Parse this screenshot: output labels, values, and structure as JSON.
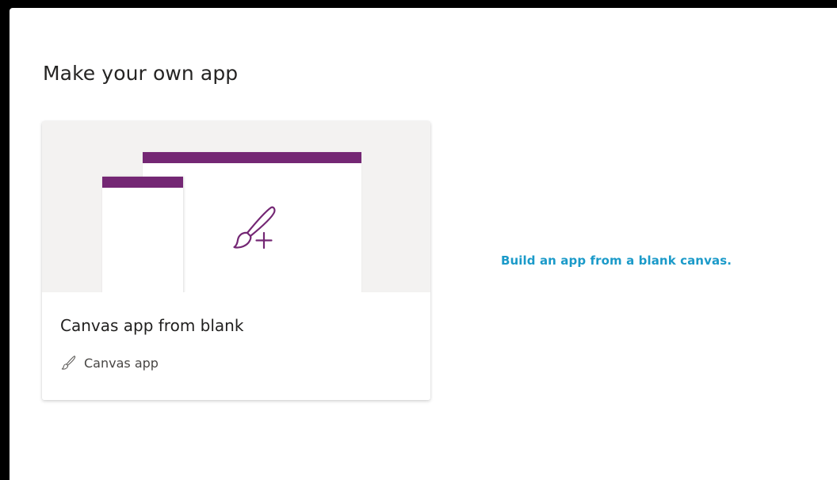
{
  "section": {
    "title": "Make your own app"
  },
  "card": {
    "title": "Canvas app from blank",
    "type_label": "Canvas app",
    "preview_icon": "paintbrush-plus-icon",
    "type_icon": "paintbrush-icon"
  },
  "description": "Build an app from a blank canvas.",
  "colors": {
    "accent_purple": "#742774",
    "link_blue": "#1b9ac9",
    "preview_bg": "#f3f2f1",
    "text_primary": "#201f1e"
  }
}
